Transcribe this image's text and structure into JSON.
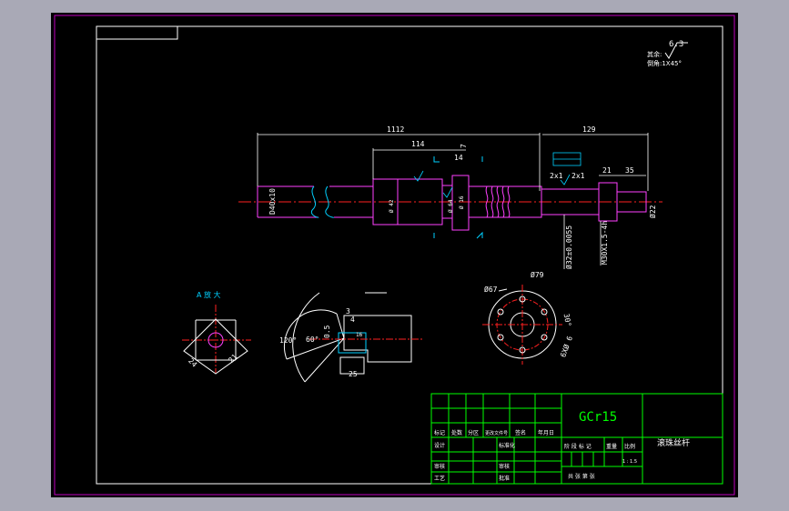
{
  "colors": {
    "background": "#a9a9b6",
    "sheet": "#000000",
    "border": "#c000c0",
    "frame": "#ffffff",
    "dimension": "#ffffff",
    "geometry": "#ff40ff",
    "centerline": "#ff2020",
    "table": "#00ff00",
    "symbol": "#00d0ff",
    "text": "#ffffff"
  },
  "notes": {
    "rest_label": "其余:",
    "rest_value": "6.3",
    "chamfer": "倒角:1X45°"
  },
  "dimensions": {
    "overall": "1112",
    "right_section": "129",
    "bearing_span": "114",
    "collar": "14",
    "step_a": "21",
    "step_b": "35",
    "chamfer_a": "2x1",
    "chamfer_b": "2x1",
    "small_1": "7",
    "bore": "D40x10",
    "journal": "Ø32±0.0055",
    "thread": "M30X1.5-4h",
    "end_dia": "Ø22",
    "shaft_dia_a": "Ø 42",
    "flange_dia": "Ø 64",
    "ring_dia": "Ø 16",
    "keyway_depth": "0",
    "detail_a_label": "A 放 大",
    "detail_a_24": "24",
    "detail_a_21": "21",
    "angle_120": "120°",
    "angle_60": "60°",
    "dim_05": "0.5",
    "dim_4": "4",
    "dim_3": "3",
    "dim_16": "16",
    "dim_25": "25",
    "pcd_67": "Ø67",
    "pcd_79": "Ø79",
    "angle_30": "30°",
    "holes": "6XØ 6"
  },
  "title_block": {
    "material": "GCr15",
    "part_name": "滚珠丝杆",
    "h_mark": "标记",
    "h_count": "处数",
    "h_zone": "分区",
    "h_doc": "更改文件号",
    "h_sign": "签名",
    "h_date": "年月日",
    "r_design": "设计",
    "r_std": "标准化",
    "r_review": "审核",
    "r_process": "工艺",
    "r_audit": "审核",
    "r_approve": "批准",
    "stage": "阶 段 标 记",
    "weight": "重量",
    "scale": "比例",
    "scale_val": "1 : 1.5",
    "sheets": "共   张  第   张"
  }
}
